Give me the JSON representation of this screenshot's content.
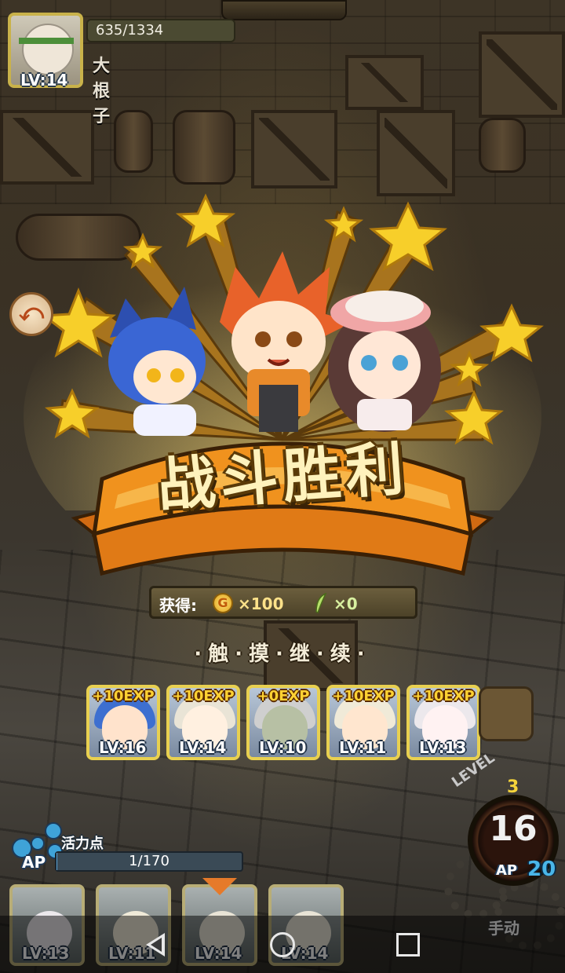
{
  "player": {
    "exp_text": "635/1334",
    "name": "大根子",
    "level": "LV:14"
  },
  "battle": {
    "title": "战斗胜利",
    "reward_label": "获得:",
    "gold_icon_letter": "G",
    "gold_amount": "×100",
    "feather_amount": "×0",
    "tap_prompt": "·触·摸·继·续·"
  },
  "exp_cards": [
    {
      "gain": "+10EXP",
      "level": "LV:16",
      "hair": "#3d6fd0",
      "skin": "#ffe3cc"
    },
    {
      "gain": "+10EXP",
      "level": "LV:14",
      "hair": "#e9e4d6",
      "skin": "#fff0e0"
    },
    {
      "gain": "+0EXP",
      "level": "LV:10",
      "hair": "#cfcfcf",
      "skin": "#b7c0a4"
    },
    {
      "gain": "+10EXP",
      "level": "LV:11",
      "hair": "#f0ead8",
      "skin": "#ffe6cf"
    },
    {
      "gain": "+10EXP",
      "level": "LV:13",
      "hair": "#ece8ec",
      "skin": "#fff2f2"
    }
  ],
  "ap": {
    "label": "活力点",
    "tag": "AP",
    "value_text": "1/170",
    "fraction": 0.006
  },
  "level_dial": {
    "level_word": "LEVEL",
    "level_num": "3",
    "count": "16",
    "ap_tag": "AP",
    "ap_value": "20",
    "manual_label": "手动"
  },
  "party": [
    {
      "level": "LV:13",
      "hair": "#ece8ec"
    },
    {
      "level": "LV:11",
      "hair": "#f0ead8"
    },
    {
      "level": "LV:14",
      "hair": "#e9e4d6"
    },
    {
      "level": "LV:14",
      "hair": "#e9e4d6"
    }
  ],
  "colors": {
    "accent_orange": "#e88a2a",
    "gold_yellow": "#f5c92e",
    "ap_blue": "#4ab6e8"
  },
  "icons": [
    "back-icon",
    "home-icon",
    "recent-apps-icon",
    "return-icon",
    "coin-icon",
    "feather-icon",
    "gear-icon"
  ]
}
